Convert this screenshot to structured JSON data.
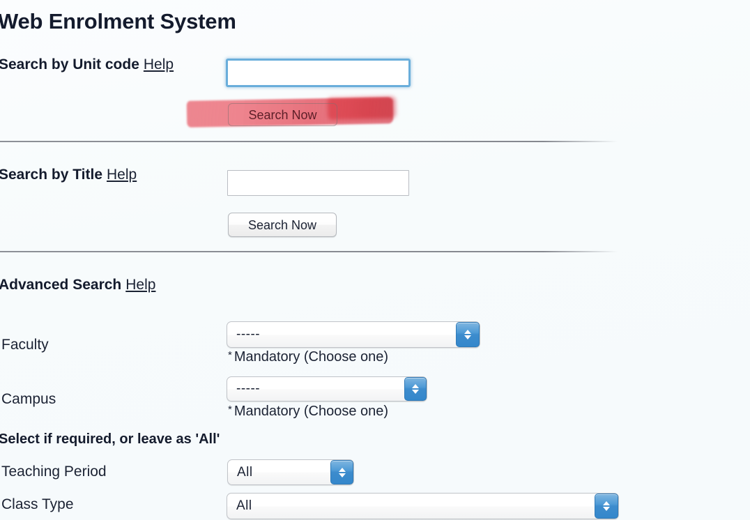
{
  "app": {
    "title": "Web Enrolment System"
  },
  "unit_code_search": {
    "label": "Search by Unit code",
    "help_label": "Help",
    "input_value": "",
    "input_placeholder": "",
    "button_label": "Search Now",
    "highlighted": true,
    "highlight_color": "#ee6e7a"
  },
  "title_search": {
    "label": "Search by Title",
    "help_label": "Help",
    "input_value": "",
    "input_placeholder": "",
    "button_label": "Search Now"
  },
  "advanced_search": {
    "label": "Advanced Search",
    "help_label": "Help",
    "fields": [
      {
        "label": "Faculty",
        "value": "-----",
        "note": "Mandatory (Choose one)",
        "note_star": "*"
      },
      {
        "label": "Campus",
        "value": "-----",
        "note": "Mandatory (Choose one)",
        "note_star": "*"
      }
    ],
    "optional_heading": "Select if required, or leave as 'All'",
    "optional_fields": [
      {
        "label": "Teaching Period",
        "value": "All"
      },
      {
        "label": "Class Type",
        "value": "All"
      }
    ]
  },
  "theme": {
    "accent_blue": "#3d8ccd",
    "focus_blue": "#6aaedb",
    "text": "#1b2233",
    "divider": "#85888f",
    "background": "#f7fbfc"
  }
}
